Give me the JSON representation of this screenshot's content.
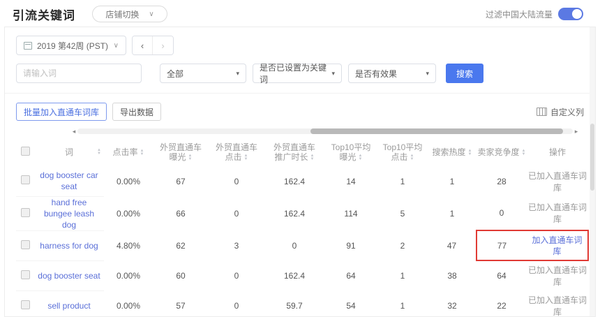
{
  "colors": {
    "accent_blue": "#4a78ee",
    "toggle_blue": "#5b79e3",
    "link_blue": "#5a6fd8",
    "highlight_red": "#e03a34"
  },
  "icons": {
    "chevron_down": "∨",
    "select_caret": "▾",
    "chevron_left": "‹",
    "chevron_right": "›",
    "scroll_left": "◂",
    "scroll_right": "▸"
  },
  "header": {
    "title": "引流关键词",
    "shop_switch_label": "店铺切换",
    "filter_traffic_label": "过滤中国大陆流量",
    "filter_traffic_on": true
  },
  "date_bar": {
    "date_label": "2019 第42周 (PST)"
  },
  "filters": {
    "keyword_placeholder": "请输入词",
    "scope_select_value": "全部",
    "keyword_set_select_value": "是否已设置为关键词",
    "effective_select_value": "是否有效果",
    "search_button_label": "搜索"
  },
  "toolbar": {
    "batch_add_label": "批量加入直通车词库",
    "export_label": "导出数据",
    "customize_columns_label": "自定义列"
  },
  "table": {
    "columns": [
      {
        "key": "word",
        "label": "词",
        "sortable": true
      },
      {
        "key": "ctr",
        "label": "点击率",
        "sortable": true
      },
      {
        "key": "p4p-impressions",
        "label": "外贸直通车\n曝光",
        "sortable": true
      },
      {
        "key": "p4p-clicks",
        "label": "外贸直通车\n点击",
        "sortable": true
      },
      {
        "key": "p4p-duration",
        "label": "外贸直通车\n推广时长",
        "sortable": true
      },
      {
        "key": "top10-impressions",
        "label": "Top10平均\n曝光",
        "sortable": true
      },
      {
        "key": "top10-clicks",
        "label": "Top10平均\n点击",
        "sortable": true
      },
      {
        "key": "search-heat",
        "label": "搜索热度",
        "sortable": true
      },
      {
        "key": "competition",
        "label": "卖家竞争度",
        "sortable": true
      },
      {
        "key": "action",
        "label": "操作",
        "sortable": false
      }
    ],
    "rows": [
      {
        "word": "dog booster car seat",
        "cells": [
          "0.00%",
          "67",
          "0",
          "162.4",
          "14",
          "1",
          "1",
          "28"
        ],
        "action": "已加入直通车词库",
        "action_is_link": false,
        "highlight": false
      },
      {
        "word": "hand free bungee leash dog",
        "cells": [
          "0.00%",
          "66",
          "0",
          "162.4",
          "114",
          "5",
          "1",
          "0"
        ],
        "action": "已加入直通车词库",
        "action_is_link": false,
        "highlight": false
      },
      {
        "word": "harness for dog",
        "cells": [
          "4.80%",
          "62",
          "3",
          "0",
          "91",
          "2",
          "47",
          "77"
        ],
        "action": "加入直通车词库",
        "action_is_link": true,
        "highlight": true
      },
      {
        "word": "dog booster seat",
        "cells": [
          "0.00%",
          "60",
          "0",
          "162.4",
          "64",
          "1",
          "38",
          "64"
        ],
        "action": "已加入直通车词库",
        "action_is_link": false,
        "highlight": false
      },
      {
        "word": "sell product",
        "cells": [
          "0.00%",
          "57",
          "0",
          "59.7",
          "54",
          "1",
          "32",
          "22"
        ],
        "action": "已加入直通车词库",
        "action_is_link": false,
        "highlight": false
      }
    ]
  }
}
